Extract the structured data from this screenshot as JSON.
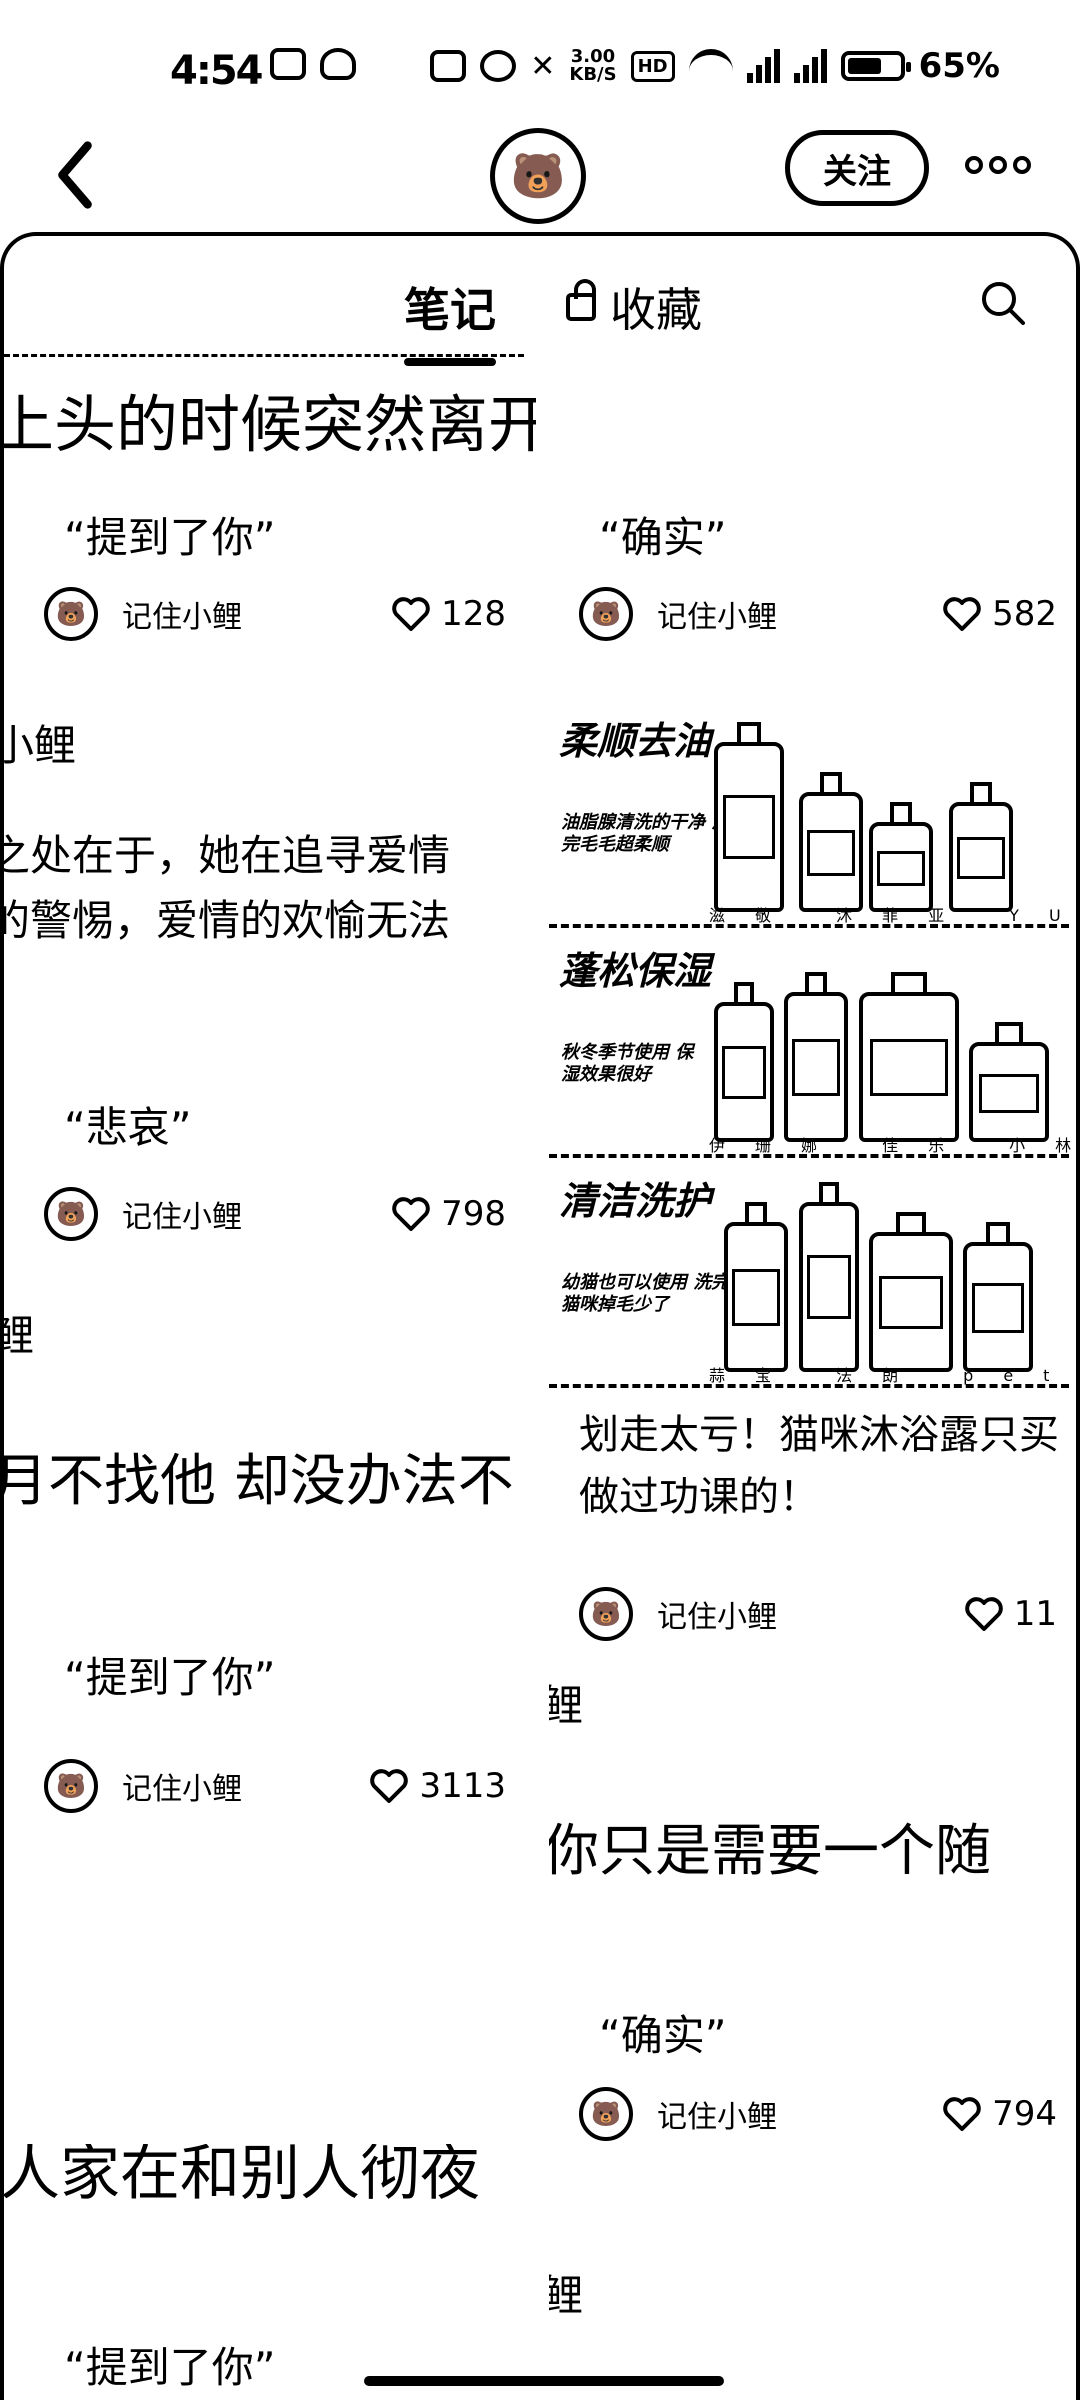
{
  "status_bar": {
    "time": "4:54",
    "net_speed_value": "3.00",
    "net_speed_unit": "KB/S",
    "hd_label": "HD",
    "battery_percent": "65%",
    "battery_level": 0.65
  },
  "nav": {
    "follow_label": "关注"
  },
  "tabs": {
    "notes": "笔记",
    "saved": "收藏"
  },
  "feed": {
    "left": [
      {
        "fragment": "上头的时候突然离开",
        "title": "“提到了你”",
        "author": "记住小鲤",
        "likes": "128"
      },
      {
        "fragment_head": "小鲤",
        "fragment_lines": [
          "之处在于，她在追寻爱情",
          "的警惕，爱情的欢愉无法",
          "。"
        ],
        "title": "“悲哀”",
        "author": "记住小鲤",
        "likes": "798"
      },
      {
        "fragment_head": "鲤",
        "fragment": "月不找他 却没办法不",
        "title": "“提到了你”",
        "author": "记住小鲤",
        "likes": "3113"
      },
      {
        "fragment": "人家在和别人彻夜",
        "title": "“提到了你”"
      }
    ],
    "right": [
      {
        "title": "“确实”",
        "author": "记住小鲤",
        "likes": "582"
      },
      {
        "image": {
          "rows": [
            {
              "label": "柔顺去油",
              "sub": "油脂腺清洗的干净 洗完毛毛超柔顺",
              "brands": "滋敬 沐菲亚 YU 开麦"
            },
            {
              "label": "蓬松保湿",
              "sub": "秋冬季节使用 保湿效果很好",
              "brands": "伊珊娜 佳乐 小林制药 阿鲁"
            },
            {
              "label": "清洁洗护",
              "sub": "幼猫也可以使用 洗完猫咪掉毛少了",
              "brands": "蒜宝 法朗 petshy 斯菲普"
            }
          ]
        },
        "title": "划走太亏！猫咪沐浴露只买做过功课的！",
        "author": "记住小鲤",
        "likes": "11"
      },
      {
        "fragment_head": "鲤",
        "fragment": "你只是需要一个随",
        "title": "“确实”",
        "author": "记住小鲤",
        "likes": "794"
      },
      {
        "fragment_head": "鲤"
      }
    ]
  },
  "icons": {
    "back": "chevron-left-icon",
    "more": "more-dots-icon",
    "search": "search-icon",
    "lock": "lock-icon",
    "heart": "heart-icon"
  }
}
